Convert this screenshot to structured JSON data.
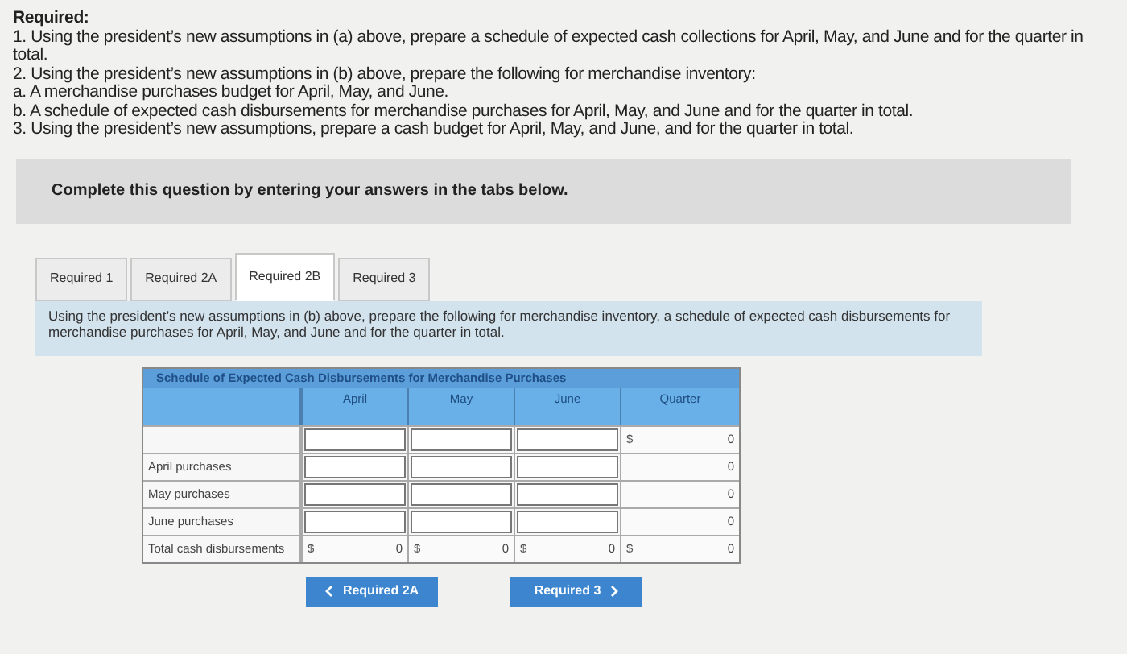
{
  "required_heading": "Required:",
  "instructions": [
    "1. Using the president’s new assumptions in (a) above, prepare a schedule of expected cash collections for April, May, and June and for the quarter in total.",
    "2. Using the president’s new assumptions in (b) above, prepare the following for merchandise inventory:",
    "a. A merchandise purchases budget for April, May, and June.",
    "b. A schedule of expected cash disbursements for merchandise purchases for April, May, and June and for the quarter in total.",
    "3. Using the president’s new assumptions, prepare a cash budget for April, May, and June, and for the quarter in total."
  ],
  "banner": "Complete this question by entering your answers in the tabs below.",
  "tabs": [
    {
      "label": "Required 1",
      "selected": false
    },
    {
      "label": "Required 2A",
      "selected": false
    },
    {
      "label": "Required 2B",
      "selected": true
    },
    {
      "label": "Required 3",
      "selected": false
    }
  ],
  "prompt": "Using the president’s new assumptions in (b) above, prepare the following for merchandise inventory, a schedule of expected cash disbursements for merchandise purchases for April, May, and June and for the quarter in total.",
  "table": {
    "title": "Schedule of Expected Cash Disbursements for Merchandise Purchases",
    "columns": [
      "April",
      "May",
      "June",
      "Quarter"
    ],
    "rows": [
      {
        "cells": [
          {
            "kind": "input"
          },
          {
            "kind": "input"
          },
          {
            "kind": "input"
          },
          {
            "kind": "value",
            "prefix": "$",
            "value": "0"
          }
        ]
      },
      {
        "label": "April purchases",
        "cells": [
          {
            "kind": "input"
          },
          {
            "kind": "input"
          },
          {
            "kind": "input"
          },
          {
            "kind": "value",
            "value": "0"
          }
        ]
      },
      {
        "label": "May purchases",
        "cells": [
          {
            "kind": "input"
          },
          {
            "kind": "input"
          },
          {
            "kind": "input"
          },
          {
            "kind": "value",
            "value": "0"
          }
        ]
      },
      {
        "label": "June purchases",
        "cells": [
          {
            "kind": "input"
          },
          {
            "kind": "input"
          },
          {
            "kind": "input"
          },
          {
            "kind": "value",
            "value": "0"
          }
        ]
      },
      {
        "label": "Total cash disbursements",
        "cells": [
          {
            "kind": "value",
            "prefix": "$",
            "value": "0"
          },
          {
            "kind": "value",
            "prefix": "$",
            "value": "0"
          },
          {
            "kind": "value",
            "prefix": "$",
            "value": "0"
          },
          {
            "kind": "value",
            "prefix": "$",
            "value": "0"
          }
        ]
      }
    ]
  },
  "buttons": [
    {
      "kind": "prev",
      "label": "Required 2A"
    },
    {
      "kind": "next",
      "label": "Required 3"
    }
  ]
}
